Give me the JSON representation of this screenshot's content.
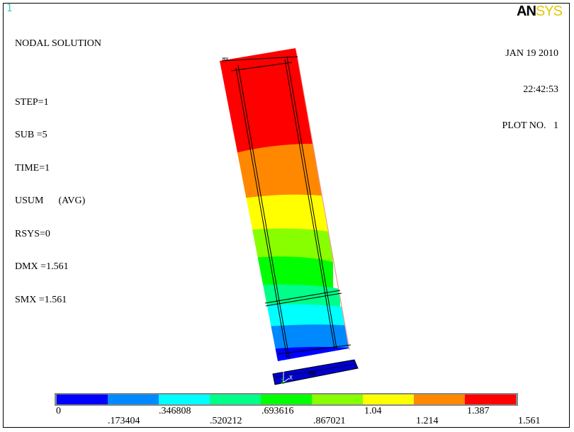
{
  "window_number": "1",
  "info": {
    "title": "NODAL SOLUTION",
    "step": "STEP=1",
    "sub": "SUB =5",
    "time": "TIME=1",
    "usum": "USUM      (AVG)",
    "rsys": "RSYS=0",
    "dmx": "DMX =1.561",
    "smx": "SMX =1.561"
  },
  "logo": {
    "part1": "AN",
    "part2": "SYS"
  },
  "header_right": {
    "date": "JAN 19 2010",
    "time": "22:42:53",
    "plot_no": "PLOT NO.   1"
  },
  "model_markers": {
    "top_label": "MX",
    "bottom_label": "MN",
    "axis_y": "Y",
    "axis_z": "Z",
    "axis_x": "X"
  },
  "legend": {
    "colors": [
      "#0000ff",
      "#0088ff",
      "#00ffff",
      "#00ff88",
      "#00ff00",
      "#88ff00",
      "#ffff00",
      "#ff8800",
      "#ff0000"
    ],
    "labels_top": [
      "0",
      ".346808",
      ".693616",
      "1.04",
      "1.387"
    ],
    "labels_bottom": [
      ".173404",
      ".520212",
      ".867021",
      "1.214",
      "1.561"
    ]
  }
}
